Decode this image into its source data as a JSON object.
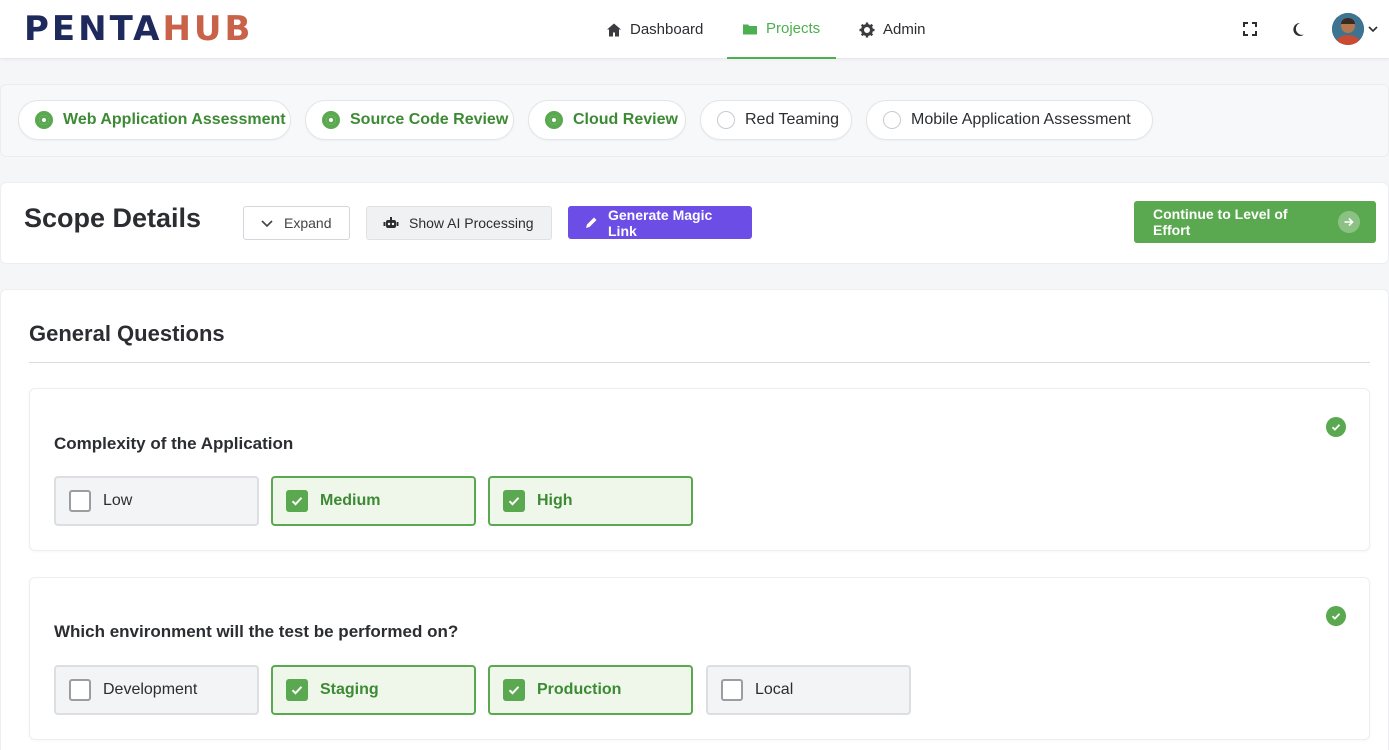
{
  "brand": {
    "part1": "PENTA",
    "part2": "HUB"
  },
  "nav": {
    "items": [
      {
        "label": "Dashboard",
        "icon": "home-icon"
      },
      {
        "label": "Projects",
        "icon": "folder-icon",
        "active": true
      },
      {
        "label": "Admin",
        "icon": "gear-icon"
      }
    ]
  },
  "topbar_icons": [
    "fullscreen-icon",
    "moon-icon",
    "avatar",
    "chevron-down-icon"
  ],
  "services": [
    {
      "label": "Web Application Assessment",
      "selected": true
    },
    {
      "label": "Source Code Review",
      "selected": true
    },
    {
      "label": "Cloud Review",
      "selected": true
    },
    {
      "label": "Red Teaming",
      "selected": false
    },
    {
      "label": "Mobile Application Assessment",
      "selected": false
    }
  ],
  "scope": {
    "title": "Scope Details",
    "expand_label": "Expand",
    "ai_label": "Show AI Processing",
    "magic_label": "Generate Magic Link",
    "continue_label": "Continue to Level of Effort"
  },
  "section": {
    "title": "General Questions",
    "questions": [
      {
        "title": "Complexity of the Application",
        "answered": true,
        "options": [
          {
            "label": "Low",
            "checked": false
          },
          {
            "label": "Medium",
            "checked": true
          },
          {
            "label": "High",
            "checked": true
          }
        ]
      },
      {
        "title": "Which environment will the test be performed on?",
        "answered": true,
        "options": [
          {
            "label": "Development",
            "checked": false
          },
          {
            "label": "Staging",
            "checked": true
          },
          {
            "label": "Production",
            "checked": true
          },
          {
            "label": "Local",
            "checked": false
          }
        ]
      }
    ]
  },
  "colors": {
    "accent_green": "#5aa84f",
    "purple": "#6c4ee6",
    "brand_navy": "#1f2a5c",
    "brand_orange": "#c8634a"
  }
}
